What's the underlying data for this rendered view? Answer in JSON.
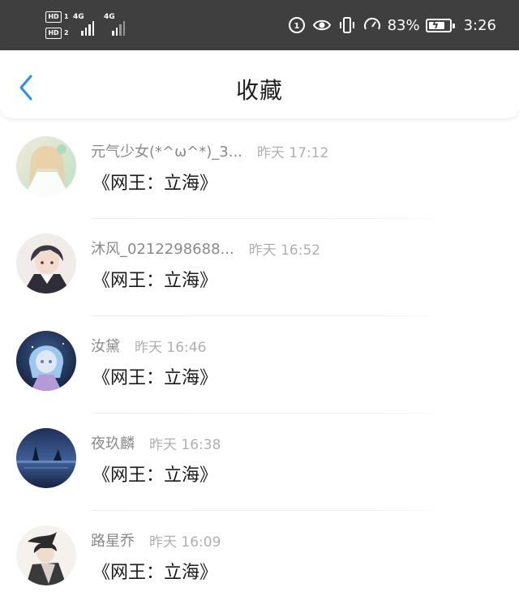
{
  "status_bar": {
    "sim1_badge": "HD",
    "sim1_index": "1",
    "sim2_badge": "HD",
    "sim2_index": "2",
    "net1": "4G",
    "net2": "4G",
    "battery_percent": "83%",
    "battery_level": 0.83,
    "time": "3:26",
    "icons": [
      "data-saver-icon",
      "eye-icon",
      "vibrate-icon",
      "speed-meter-icon",
      "battery-charging-icon"
    ]
  },
  "header": {
    "title": "收藏",
    "back_icon": "chevron-left-icon",
    "accent_color": "#2b8ef0"
  },
  "items": [
    {
      "username": "元气少女(*^ω^*)_3...",
      "time": "昨天 17:12",
      "title": "《网王：立海》",
      "avatar_palette": [
        "#d9ecd6",
        "#f3e7d6",
        "#b9dcc6"
      ]
    },
    {
      "username": "沐风_0212298688...",
      "time": "昨天 16:52",
      "title": "《网王：立海》",
      "avatar_palette": [
        "#efe8e6",
        "#3b3640",
        "#c9a58f"
      ]
    },
    {
      "username": "汝黛",
      "time": "昨天 16:46",
      "title": "《网王：立海》",
      "avatar_palette": [
        "#1b2a4a",
        "#7fb4e6",
        "#b89ad8"
      ]
    },
    {
      "username": "夜玖麟",
      "time": "昨天 16:38",
      "title": "《网王：立海》",
      "avatar_palette": [
        "#233b6b",
        "#4a6ca3",
        "#1a2748"
      ]
    },
    {
      "username": "路星乔",
      "time": "昨天 16:09",
      "title": "《网王：立海》",
      "avatar_palette": [
        "#f4f1ec",
        "#2a2a2a",
        "#9a8f86"
      ]
    }
  ]
}
